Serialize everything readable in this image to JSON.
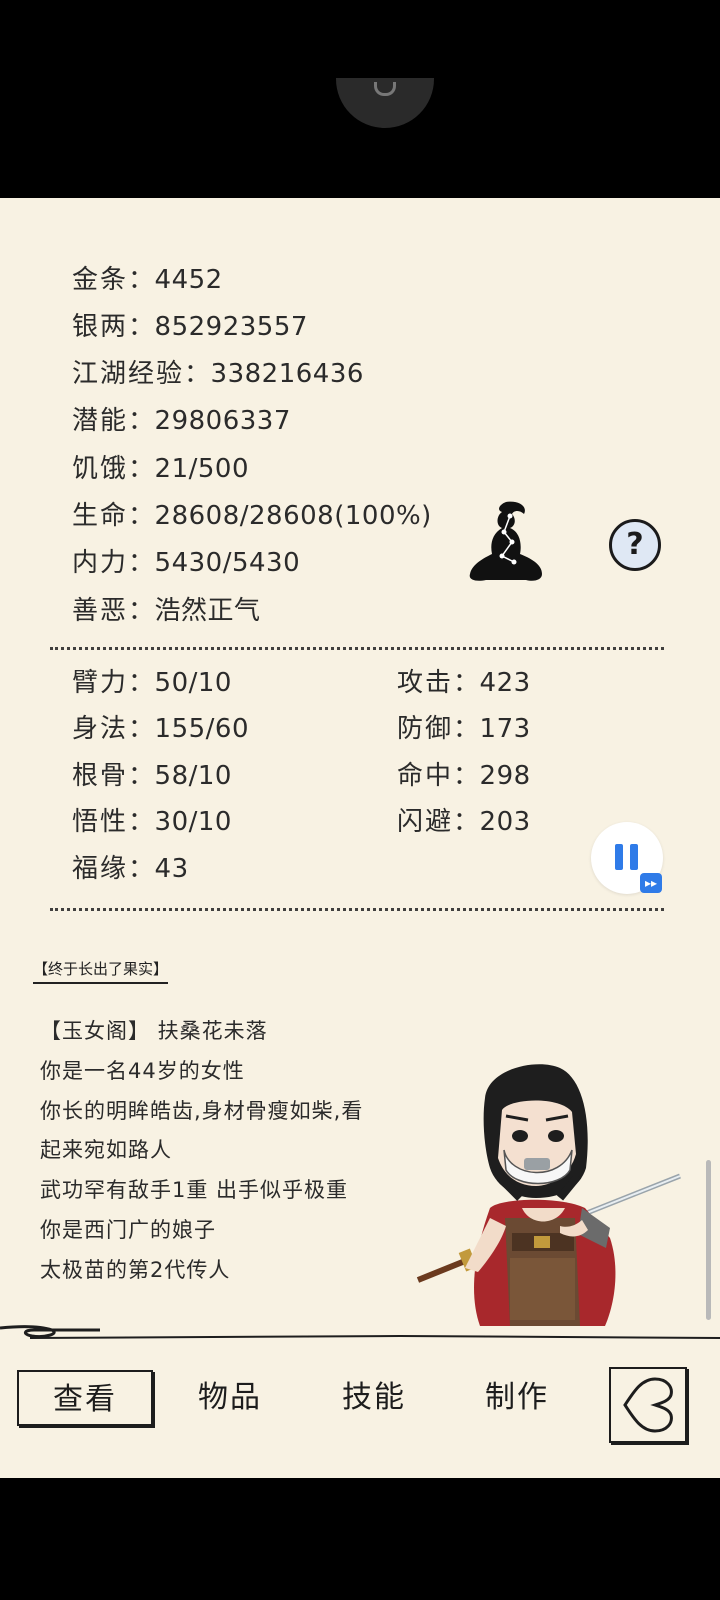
{
  "stats": [
    {
      "label": "金条",
      "value": "4452"
    },
    {
      "label": "银两",
      "value": "852923557"
    },
    {
      "label": "江湖经验",
      "value": "338216436"
    },
    {
      "label": "潜能",
      "value": "29806337"
    },
    {
      "label": "饥饿",
      "value": "21/500"
    },
    {
      "label": "生命",
      "value": "28608/28608(100%)"
    },
    {
      "label": "内力",
      "value": "5430/5430"
    },
    {
      "label": "善恶",
      "value": "浩然正气"
    }
  ],
  "attributes": [
    {
      "label": "臂力",
      "value": "50/10"
    },
    {
      "label": "身法",
      "value": "155/60"
    },
    {
      "label": "根骨",
      "value": "58/10"
    },
    {
      "label": "悟性",
      "value": "30/10"
    },
    {
      "label": "福缘",
      "value": "43"
    }
  ],
  "combat": [
    {
      "label": "攻击",
      "value": "423"
    },
    {
      "label": "防御",
      "value": "173"
    },
    {
      "label": "命中",
      "value": "298"
    },
    {
      "label": "闪避",
      "value": "203"
    }
  ],
  "separator": "：",
  "help_symbol": "?",
  "fast_forward_symbol": "▸▸",
  "event_title": "【终于长出了果实】",
  "bio_lines": [
    "【玉女阁】 扶桑花未落",
    "你是一名44岁的女性",
    "你长的明眸皓齿,身材骨瘦如柴,看",
    "起来宛如路人",
    "武功罕有敌手1重 出手似乎极重",
    "你是西门广的娘子",
    "太极苗的第2代传人"
  ],
  "nav": {
    "view": "查看",
    "items": "物品",
    "skills": "技能",
    "craft": "制作"
  },
  "colors": {
    "panel_bg": "#f8f2e3",
    "accent_blue": "#2f7be8",
    "ink": "#1d1d1d"
  },
  "icons": [
    "meditate-icon",
    "help-icon",
    "pause-icon",
    "fast-forward-icon",
    "back-icon"
  ]
}
